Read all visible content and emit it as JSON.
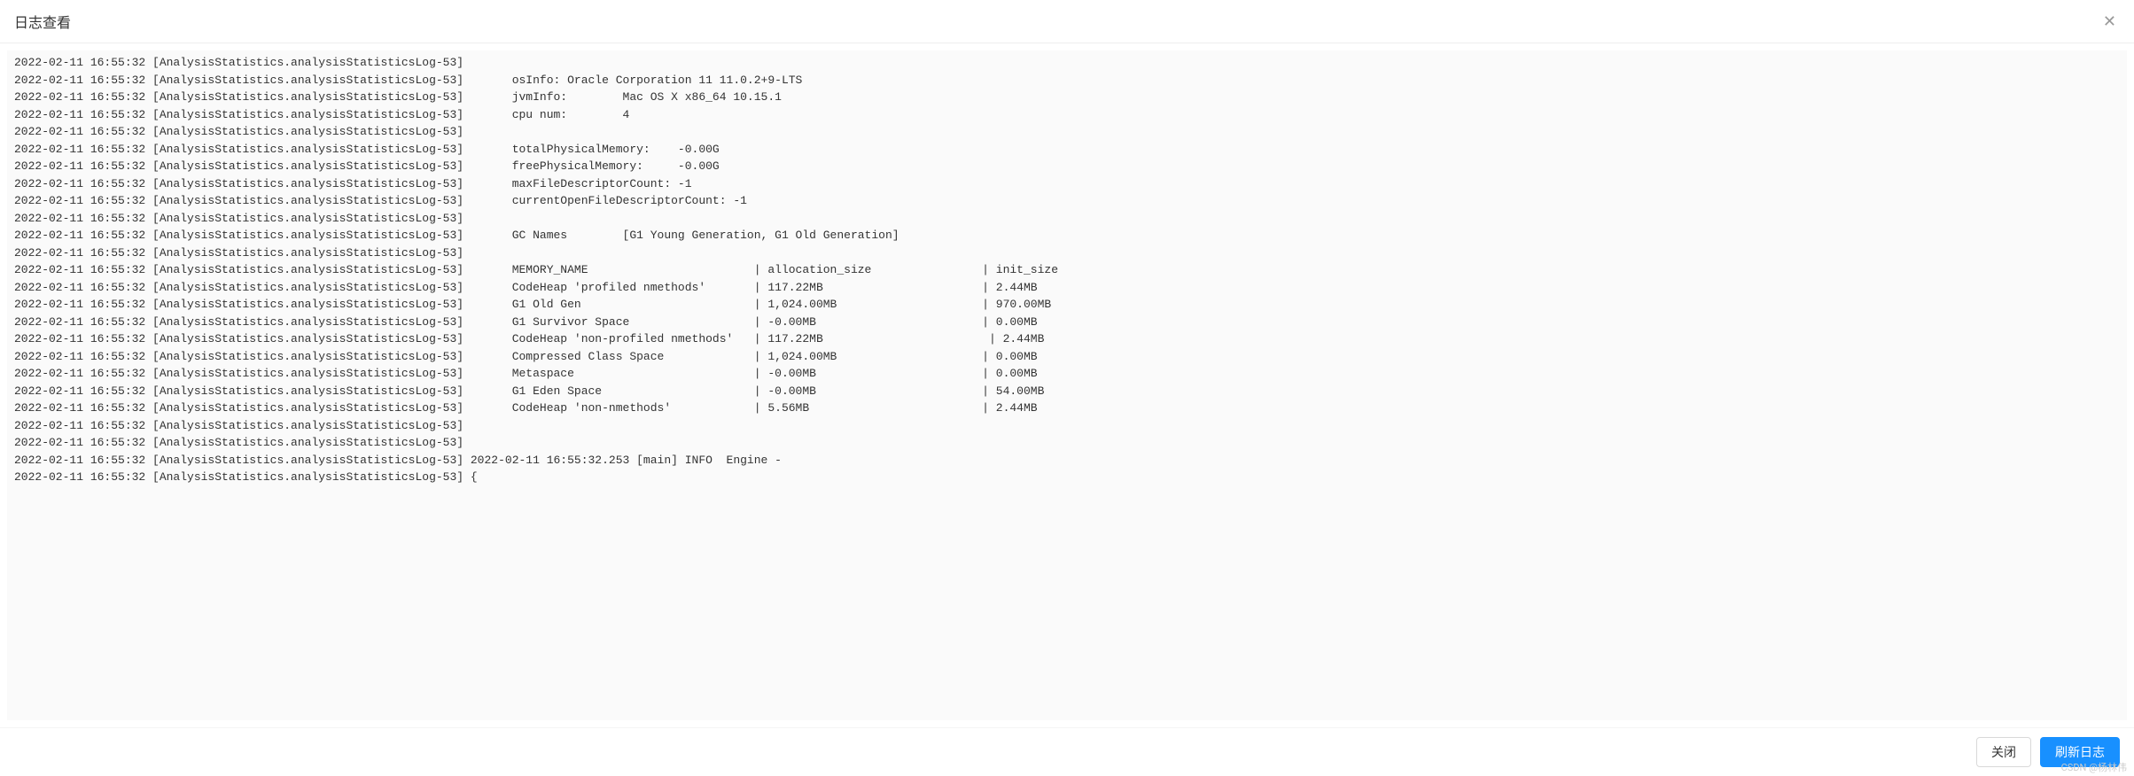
{
  "modal": {
    "title": "日志查看",
    "close_icon": "✕"
  },
  "log_prefix": "2022-02-11 16:55:32 [AnalysisStatistics.analysisStatisticsLog-53]",
  "log_lines": [
    {
      "content": ""
    },
    {
      "content": "       osInfo: Oracle Corporation 11 11.0.2+9-LTS"
    },
    {
      "content": "       jvmInfo:        Mac OS X x86_64 10.15.1"
    },
    {
      "content": "       cpu num:        4"
    },
    {
      "content": ""
    },
    {
      "content": "       totalPhysicalMemory:    -0.00G"
    },
    {
      "content": "       freePhysicalMemory:     -0.00G"
    },
    {
      "content": "       maxFileDescriptorCount: -1"
    },
    {
      "content": "       currentOpenFileDescriptorCount: -1"
    },
    {
      "content": ""
    },
    {
      "content": "       GC Names        [G1 Young Generation, G1 Old Generation]"
    },
    {
      "content": ""
    },
    {
      "content": "       MEMORY_NAME                        | allocation_size                | init_size"
    },
    {
      "content": "       CodeHeap 'profiled nmethods'       | 117.22MB                       | 2.44MB"
    },
    {
      "content": "       G1 Old Gen                         | 1,024.00MB                     | 970.00MB"
    },
    {
      "content": "       G1 Survivor Space                  | -0.00MB                        | 0.00MB"
    },
    {
      "content": "       CodeHeap 'non-profiled nmethods'   | 117.22MB                        | 2.44MB"
    },
    {
      "content": "       Compressed Class Space             | 1,024.00MB                     | 0.00MB"
    },
    {
      "content": "       Metaspace                          | -0.00MB                        | 0.00MB"
    },
    {
      "content": "       G1 Eden Space                      | -0.00MB                        | 54.00MB"
    },
    {
      "content": "       CodeHeap 'non-nmethods'            | 5.56MB                         | 2.44MB"
    },
    {
      "content": ""
    },
    {
      "content": ""
    },
    {
      "content": " 2022-02-11 16:55:32.253 [main] INFO  Engine -"
    },
    {
      "content": " {"
    }
  ],
  "buttons": {
    "close": "关闭",
    "refresh": "刷新日志"
  },
  "watermark": "CSDN @杨林伟"
}
